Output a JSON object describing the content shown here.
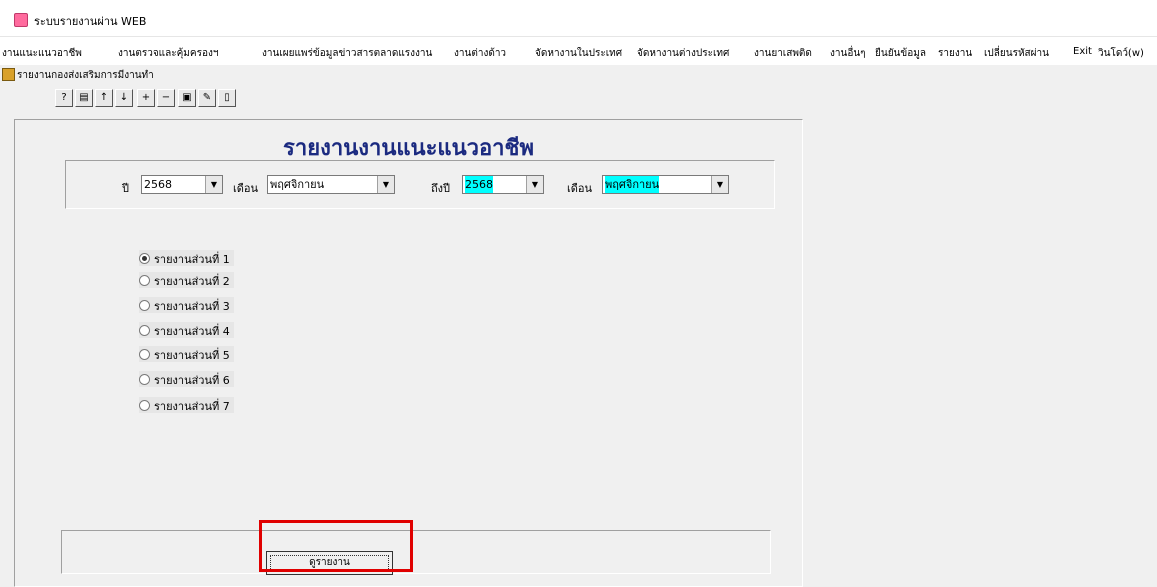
{
  "window": {
    "title": "ระบบรายงานผ่าน WEB"
  },
  "menu": [
    "งานแนะแนวอาชีพ",
    "งานตรวจและคุ้มครองฯ",
    "งานเผยแพร่ข้อมูลข่าวสารตลาดแรงงาน",
    "งานต่างด้าว",
    "จัดหางานในประเทศ",
    "จัดหางานต่างประเทศ",
    "งานยาเสพติด",
    "งานอื่นๆ",
    "ยืนยันข้อมูล",
    "รายงาน",
    "เปลี่ยนรหัสผ่าน",
    "Exit",
    "วินโดว์(w)"
  ],
  "mdi": {
    "title": "รายงานกองส่งเสริมการมีงานทำ"
  },
  "toolbar": {
    "icons": [
      "help-icon",
      "print-preview-icon",
      "arrow-up-icon",
      "arrow-down-icon",
      "add-record-icon",
      "delete-record-icon",
      "save-icon",
      "edit-icon",
      "exit-door-icon"
    ]
  },
  "form": {
    "heading": "รายงานงานแนะแนวอาชีพ",
    "year_from_label": "ปี",
    "year_from_value": "2568",
    "month_from_label": "เดือน",
    "month_from_value": "พฤศจิกายน",
    "year_to_label": "ถึงปี",
    "year_to_value": "2568",
    "month_to_label": "เดือน",
    "month_to_value": "พฤศจิกายน",
    "report_options": [
      "รายงานส่วนที่ 1",
      "รายงานส่วนที่ 2",
      "รายงานส่วนที่ 3",
      "รายงานส่วนที่ 4",
      "รายงานส่วนที่ 5",
      "รายงานส่วนที่ 6",
      "รายงานส่วนที่ 7"
    ],
    "selected_option": "รายงานส่วนที่ 1",
    "view_button": "ดูรายงาน"
  },
  "colors": {
    "heading": "#1b2a80",
    "highlight_field": "#00ffff",
    "annotation_box": "#e00000"
  }
}
